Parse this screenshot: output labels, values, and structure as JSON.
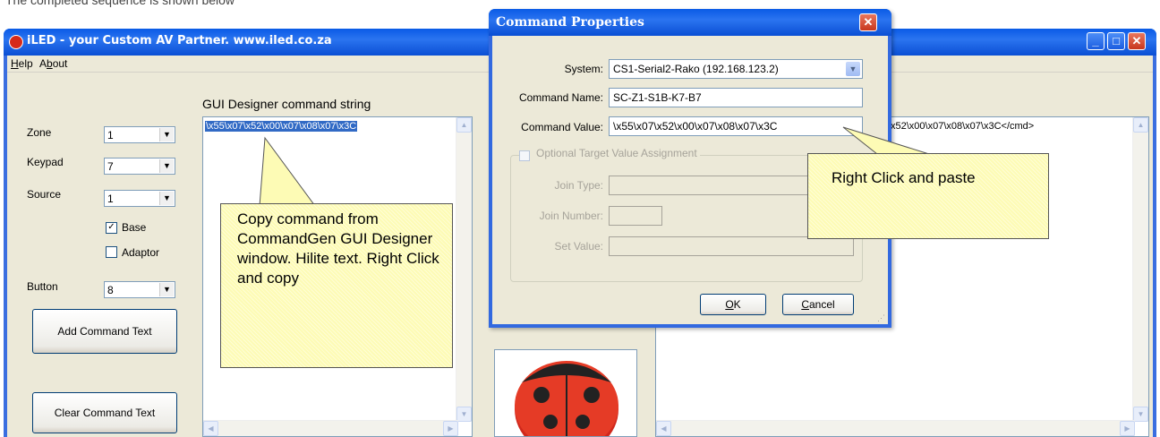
{
  "top_caption": "The completed sequence is shown below",
  "main_window": {
    "title": "iLED - your Custom AV Partner.   www.iled.co.za",
    "menu": [
      {
        "label": "Help",
        "accel": "H",
        "rest": "elp"
      },
      {
        "label": "About",
        "pre": "A",
        "accel": "b",
        "rest": "out"
      }
    ],
    "controls": {
      "zone_label": "Zone",
      "zone_value": "1",
      "keypad_label": "Keypad",
      "keypad_value": "7",
      "source_label": "Source",
      "source_value": "1",
      "base_label": "Base",
      "base_checked": true,
      "adaptor_label": "Adaptor",
      "adaptor_checked": false,
      "button_label": "Button",
      "button_value": "8",
      "add_command_text": "Add Command Text",
      "clear_command_text": "Clear Command Text"
    },
    "gui_designer_label": "GUI Designer command string",
    "gui_designer_value": "\\x55\\x07\\x52\\x00\\x07\\x08\\x07\\x3C",
    "right_panel_value": "x52\\x00\\x07\\x08\\x07\\x3C</cmd>"
  },
  "callouts": {
    "copy": "Copy command from CommandGen GUI Designer window. Hilite text. Right Click and copy",
    "paste": "Right Click and paste"
  },
  "dialog": {
    "title": "Command Properties",
    "system_label": "System:",
    "system_value": "CS1-Serial2-Rako (192.168.123.2)",
    "command_name_label": "Command Name:",
    "command_name_value": "SC-Z1-S1B-K7-B7",
    "command_value_label": "Command Value:",
    "command_value_value": "\\x55\\x07\\x52\\x00\\x07\\x08\\x07\\x3C",
    "optional_label": "Optional Target Value Assignment",
    "join_type_label": "Join Type:",
    "join_number_label": "Join Number:",
    "set_value_label": "Set Value:",
    "ok_label": "OK",
    "ok_accel": "O",
    "ok_rest": "K",
    "cancel_label": "Cancel",
    "cancel_accel": "C",
    "cancel_rest": "ancel"
  },
  "colors": {
    "titlebar": "#0a5be6",
    "window_face": "#ece9d8",
    "callout_fill": "#fdfbb5",
    "selection": "#316ac5",
    "close_button": "#c8371e"
  }
}
